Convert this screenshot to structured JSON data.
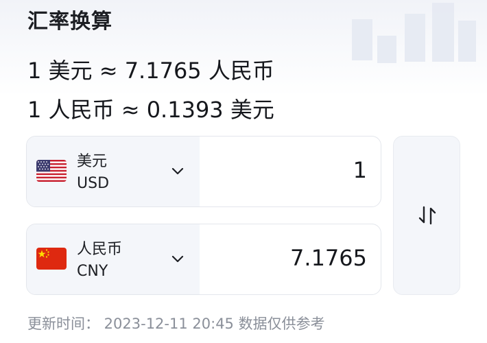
{
  "header": {
    "title": "汇率换算"
  },
  "rates": {
    "line1": "1 美元 ≈ 7.1765 人民币",
    "line2": "1 人民币 ≈ 0.1393 美元"
  },
  "converter": {
    "from": {
      "name": "美元",
      "code": "USD",
      "amount": "1",
      "flag": "us-flag-icon"
    },
    "to": {
      "name": "人民币",
      "code": "CNY",
      "amount": "7.1765",
      "flag": "cn-flag-icon"
    }
  },
  "footer": {
    "update_text": "更新时间： 2023-12-11 20:45 数据仅供参考"
  },
  "colors": {
    "accent_bg": "#f4f6fa",
    "text": "#1d1f24",
    "muted": "#8a8f99",
    "cn_red": "#de2910",
    "cn_star": "#ffde00"
  }
}
